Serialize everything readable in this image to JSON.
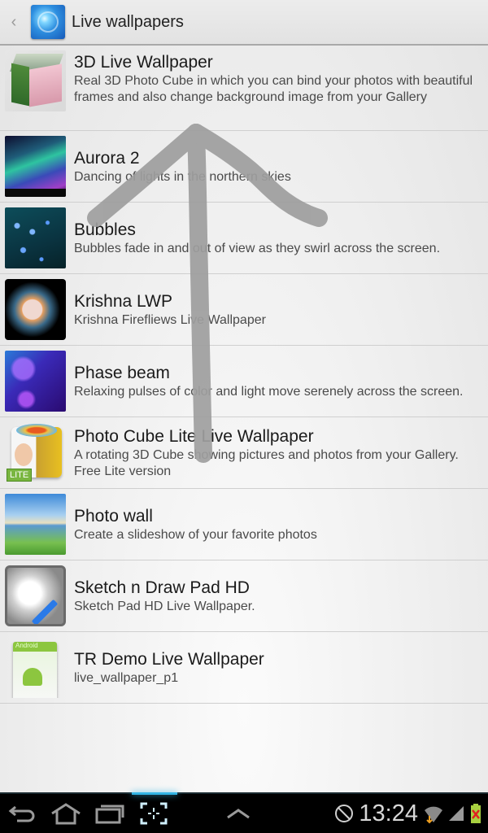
{
  "action_bar": {
    "title": "Live wallpapers",
    "up_icon": "chevron-left-icon",
    "app_icon": "live-wallpapers-icon"
  },
  "wallpapers": [
    {
      "name": "3D Live Wallpaper",
      "description": "Real 3D Photo Cube in which you can bind your photos with beautiful frames and also change background image from your Gallery",
      "thumbnail": "photo-cube-3d-thumbnail"
    },
    {
      "name": "Aurora 2",
      "description": "Dancing of lights in the northern skies",
      "thumbnail": "aurora-thumbnail"
    },
    {
      "name": "Bubbles",
      "description": "Bubbles fade in and out of view as they swirl across the screen.",
      "thumbnail": "bubbles-thumbnail"
    },
    {
      "name": "Krishna LWP",
      "description": "Krishna Firefliews Live Wallpaper",
      "thumbnail": "krishna-thumbnail"
    },
    {
      "name": "Phase beam",
      "description": "Relaxing pulses of color and light move serenely across the screen.",
      "thumbnail": "phase-beam-thumbnail"
    },
    {
      "name": "Photo Cube Lite Live Wallpaper",
      "description": "A rotating 3D Cube showing pictures and photos from your Gallery. Free Lite version",
      "thumbnail": "photo-cube-lite-thumbnail",
      "badge": "LITE"
    },
    {
      "name": "Photo wall",
      "description": "Create a slideshow of your favorite photos",
      "thumbnail": "photo-wall-thumbnail"
    },
    {
      "name": "Sketch n Draw Pad HD",
      "description": "Sketch Pad HD Live Wallpaper.",
      "thumbnail": "sketch-pad-thumbnail"
    },
    {
      "name": "TR Demo Live Wallpaper",
      "description": "live_wallpaper_p1",
      "thumbnail": "android-app-thumbnail",
      "thumb_label": "Android"
    }
  ],
  "annotation": {
    "type": "hand-drawn-arrow",
    "direction": "up",
    "color": "#9e9e9e"
  },
  "system_bar": {
    "nav": [
      "back-icon",
      "home-icon",
      "recent-apps-icon",
      "screenshot-icon",
      "menu-up-icon"
    ],
    "clock": "13:24",
    "status_icons": [
      "no-sync-icon",
      "wifi-icon",
      "signal-icon",
      "battery-icon"
    ],
    "accent_color": "#33b5e5"
  }
}
